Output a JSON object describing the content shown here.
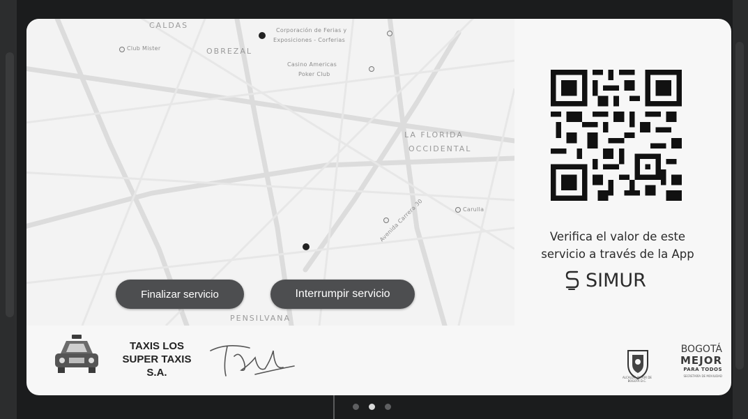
{
  "map": {
    "labels": {
      "caldas": "CALDAS",
      "obrero": "OBREZAL",
      "florida_1": "LA FLORIDA",
      "florida_2": "OCCIDENTAL",
      "pensilvania": "PENSILVANA",
      "poi_top": "Corporación de Ferias y",
      "poi_top_2": "Exposiciones - Corferias",
      "poi_left": "Club Mister",
      "poi_mid": "Casino Americas",
      "poi_mid_2": "Poker Club",
      "poi_right": "Carulla",
      "road": "Avenida Carrera 30"
    }
  },
  "buttons": {
    "finalizar": "Finalizar servicio",
    "interrumpir": "Interrumpir servicio"
  },
  "verify": {
    "line1": "Verifica el valor de este",
    "line2": "servicio a través de la App"
  },
  "simur": {
    "brand": "SIMUR",
    "icon": "simur-s-logo-icon"
  },
  "company": {
    "line1": "TAXIS LOS",
    "line2": "SUPER TAXIS",
    "line3": "S.A."
  },
  "bogota_logo": {
    "line1": "BOGOTÁ",
    "line2": "MEJOR",
    "line3": "PARA TODOS",
    "line4": "SECRETARÍA DE MOVILIDAD",
    "accent": "#d0392b"
  },
  "crest_caption": "ALCALDÍA MAYOR DE BOGOTÁ D.C.",
  "pagination": {
    "total": 3,
    "active": 2
  },
  "colors": {
    "background": "#1b1c1d",
    "card": "#f7f7f7",
    "button": "#4d4e50",
    "text": "#2a2a2a"
  }
}
